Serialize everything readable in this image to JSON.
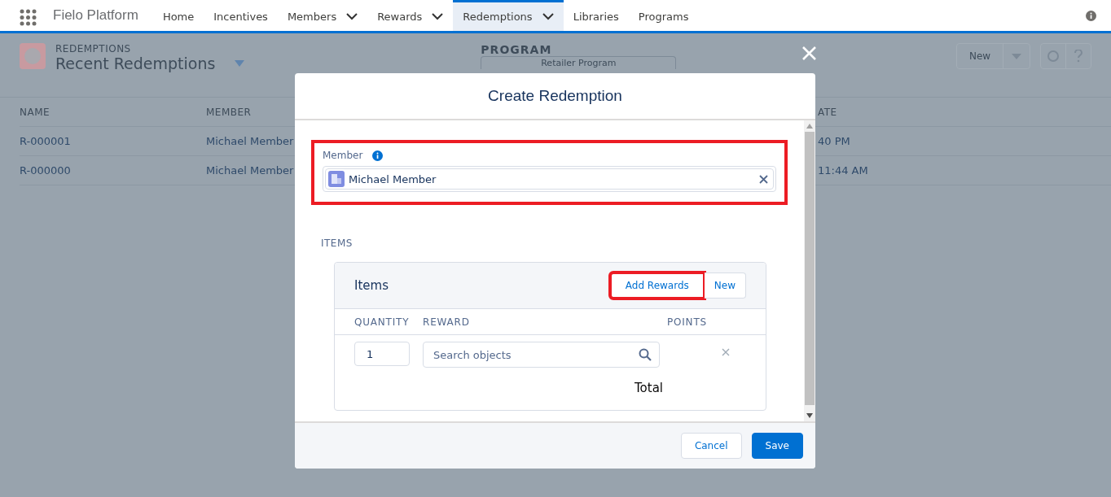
{
  "app": {
    "name": "Fielo Platform"
  },
  "nav": [
    {
      "label": "Home",
      "dropdown": false,
      "selected": false
    },
    {
      "label": "Incentives",
      "dropdown": false,
      "selected": false
    },
    {
      "label": "Members",
      "dropdown": true,
      "selected": false
    },
    {
      "label": "Rewards",
      "dropdown": true,
      "selected": false
    },
    {
      "label": "Redemptions",
      "dropdown": true,
      "selected": true
    },
    {
      "label": "Libraries",
      "dropdown": false,
      "selected": false
    },
    {
      "label": "Programs",
      "dropdown": false,
      "selected": false
    }
  ],
  "page": {
    "object": "REDEMPTIONS",
    "view": "Recent Redemptions",
    "program_label": "PROGRAM",
    "program_value": "Retailer Program",
    "new_button": "New",
    "columns": [
      "NAME",
      "MEMBER",
      "ATE"
    ],
    "rows": [
      [
        "R-000001",
        "Michael Member",
        "40 PM"
      ],
      [
        "R-000000",
        "Michael Member",
        "11:44 AM"
      ]
    ]
  },
  "modal": {
    "title": "Create Redemption",
    "member": {
      "label": "Member",
      "value": "Michael Member",
      "highlighted": true
    },
    "section": "ITEMS",
    "card": {
      "title": "Items",
      "buttons": [
        {
          "label": "Add Rewards",
          "highlighted": true
        },
        {
          "label": "New",
          "highlighted": false
        }
      ],
      "columns": [
        "QUANTITY",
        "REWARD",
        "POINTS"
      ],
      "rows": [
        {
          "quantity": "1",
          "reward_placeholder": "Search objects"
        }
      ],
      "total": "Total"
    },
    "buttons": [
      {
        "label": "Cancel",
        "kind": "neutral"
      },
      {
        "label": "Save",
        "kind": "brand"
      }
    ]
  }
}
